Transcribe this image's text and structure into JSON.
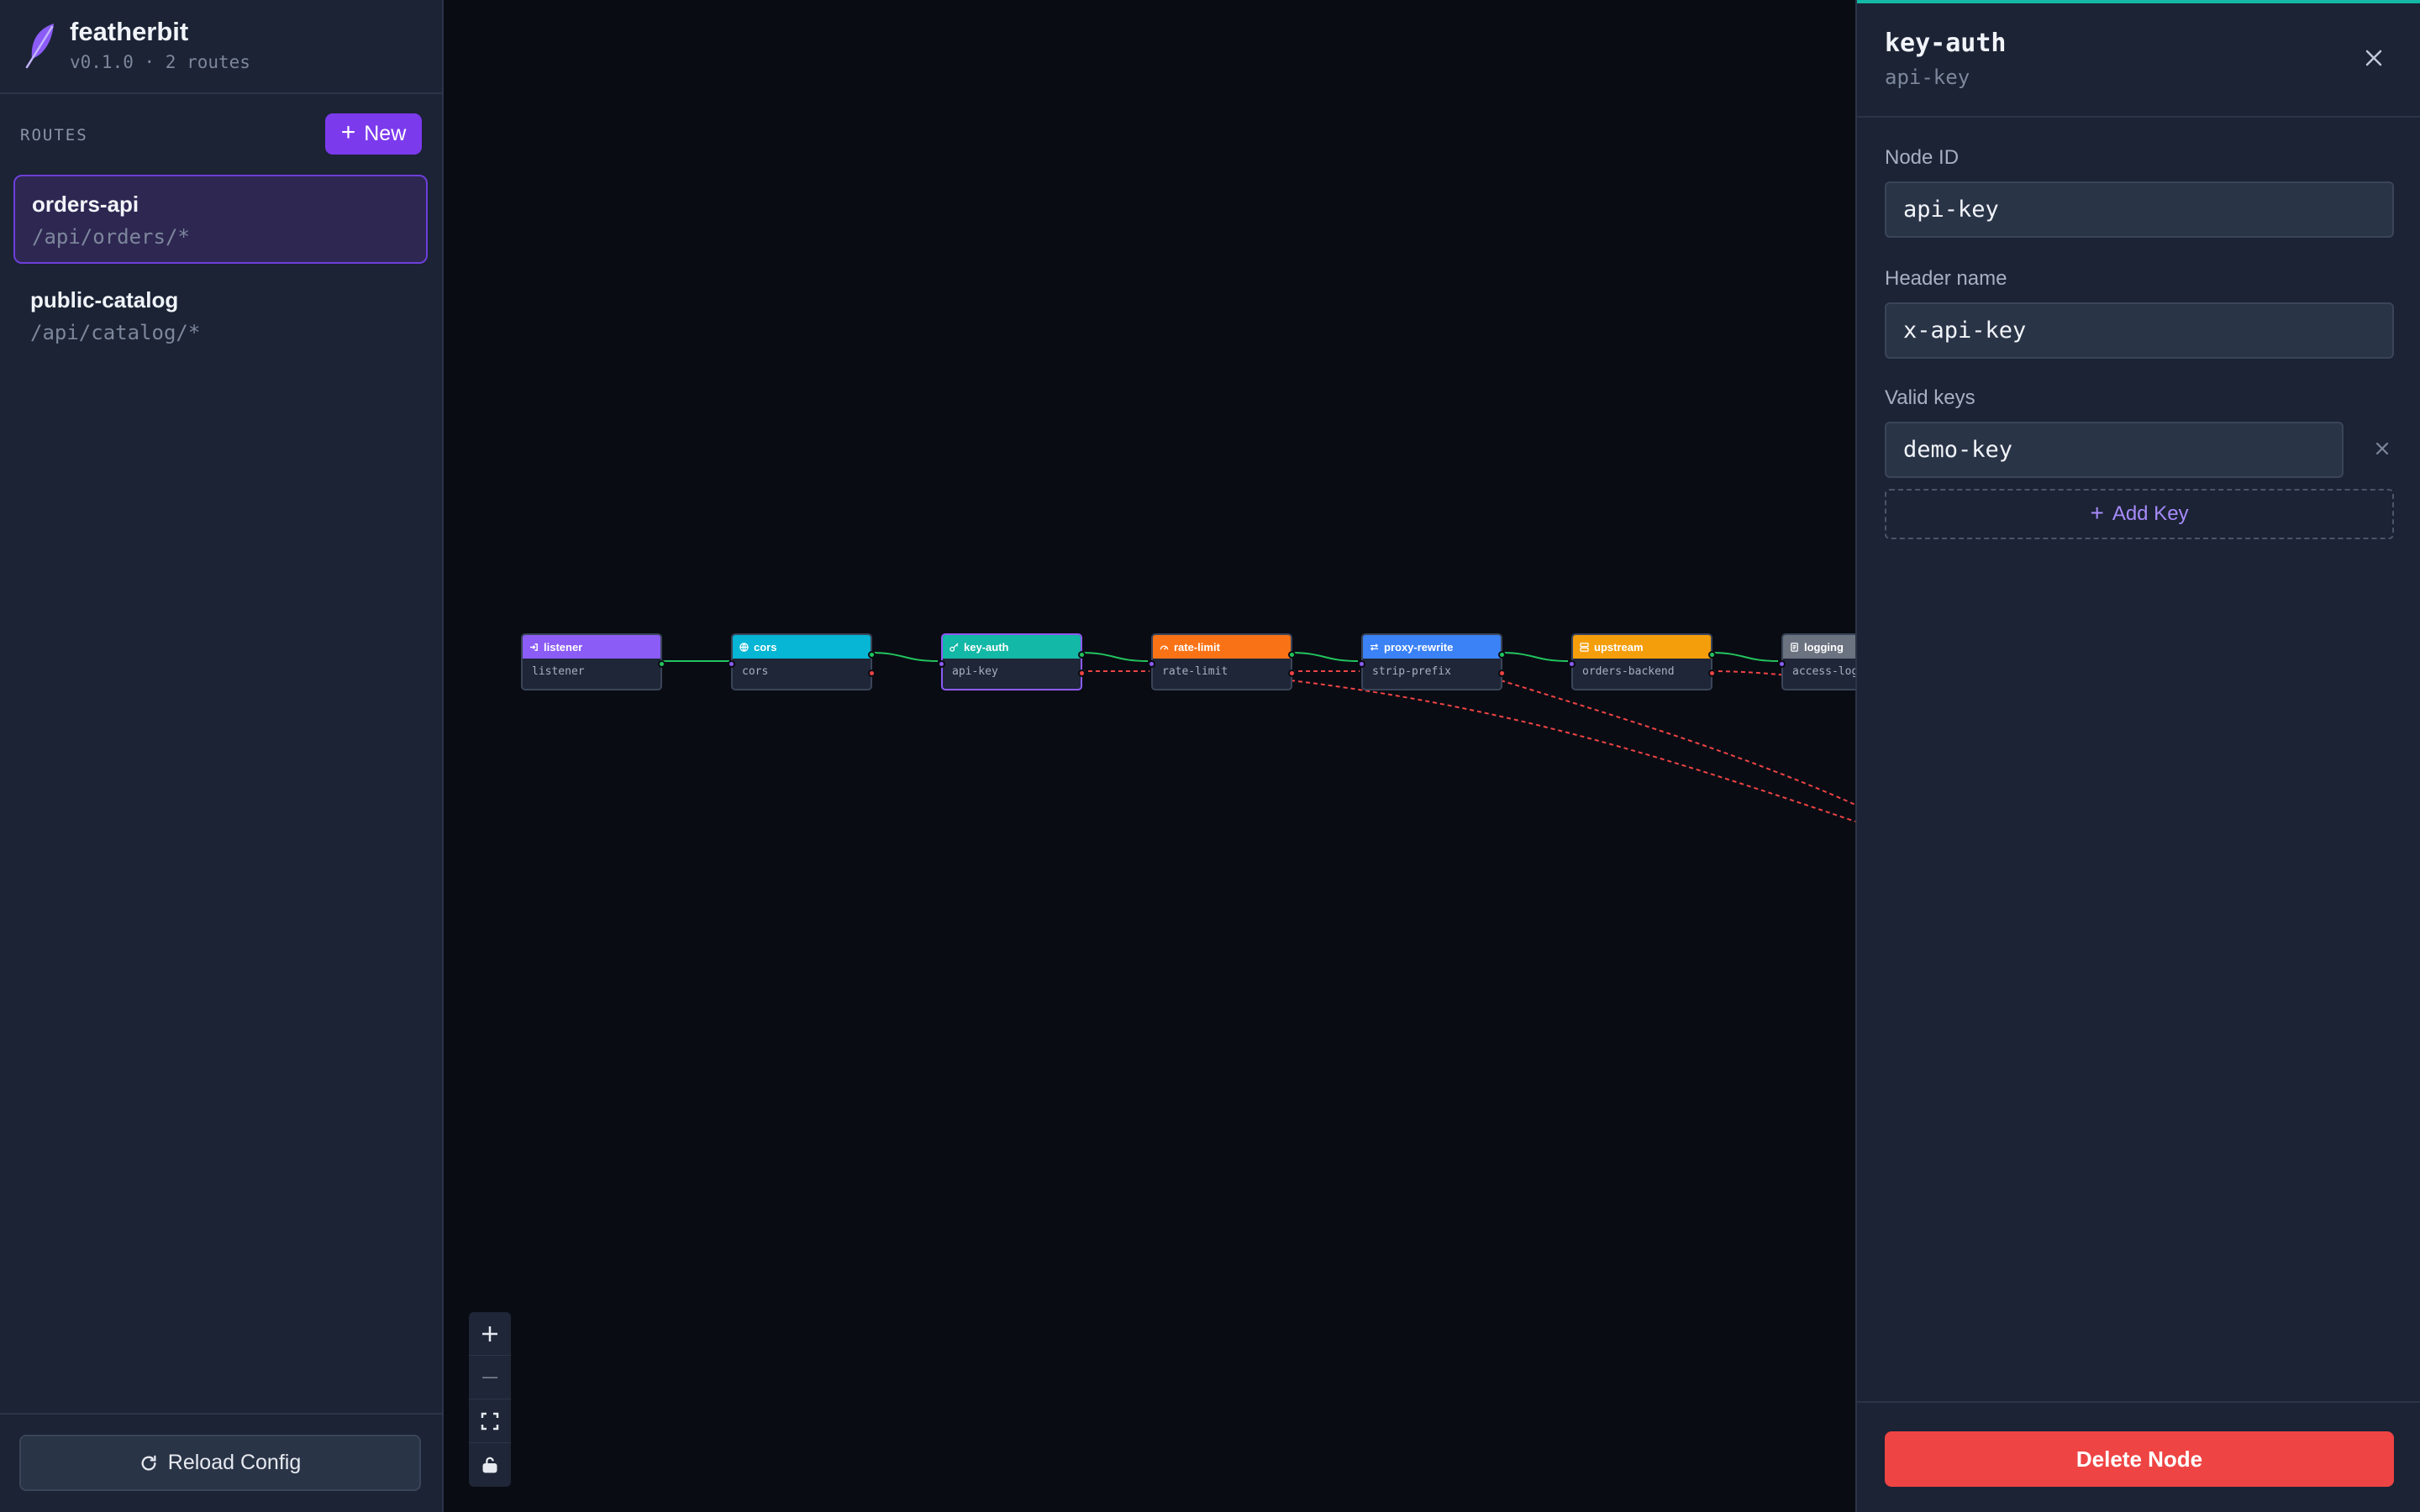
{
  "app": {
    "name": "featherbit",
    "subtitle": "v0.1.0 · 2 routes"
  },
  "sidebar": {
    "routes_label": "ROUTES",
    "new_button": "New",
    "routes": [
      {
        "name": "orders-api",
        "path": "/api/orders/*",
        "active": true
      },
      {
        "name": "public-catalog",
        "path": "/api/catalog/*",
        "active": false
      }
    ],
    "reload_button": "Reload Config"
  },
  "canvas": {
    "nodes": [
      {
        "type": "listener",
        "id": "listener",
        "color": "#8b5cf6",
        "icon": "login-icon"
      },
      {
        "type": "cors",
        "id": "cors",
        "color": "#06b6d4",
        "icon": "globe-icon"
      },
      {
        "type": "key-auth",
        "id": "api-key",
        "color": "#14b8a6",
        "icon": "key-icon",
        "selected": true
      },
      {
        "type": "rate-limit",
        "id": "rate-limit",
        "color": "#f97316",
        "icon": "gauge-icon"
      },
      {
        "type": "proxy-rewrite",
        "id": "strip-prefix",
        "color": "#3b82f6",
        "icon": "swap-icon"
      },
      {
        "type": "upstream",
        "id": "orders-backend",
        "color": "#f59e0b",
        "icon": "server-icon"
      },
      {
        "type": "logging",
        "id": "access-log",
        "color": "#6b7280",
        "icon": "log-icon"
      }
    ],
    "zoom_controls": [
      "zoom-in",
      "zoom-out",
      "fit-view",
      "lock"
    ]
  },
  "panel": {
    "title": "key-auth",
    "subtitle": "api-key",
    "fields": {
      "node_id_label": "Node ID",
      "node_id_value": "api-key",
      "header_name_label": "Header name",
      "header_name_value": "x-api-key",
      "valid_keys_label": "Valid keys",
      "valid_keys": [
        "demo-key"
      ]
    },
    "add_key_button": "Add Key",
    "delete_button": "Delete Node",
    "accent_color": "#14b8a6",
    "danger_color": "#ef4444"
  }
}
